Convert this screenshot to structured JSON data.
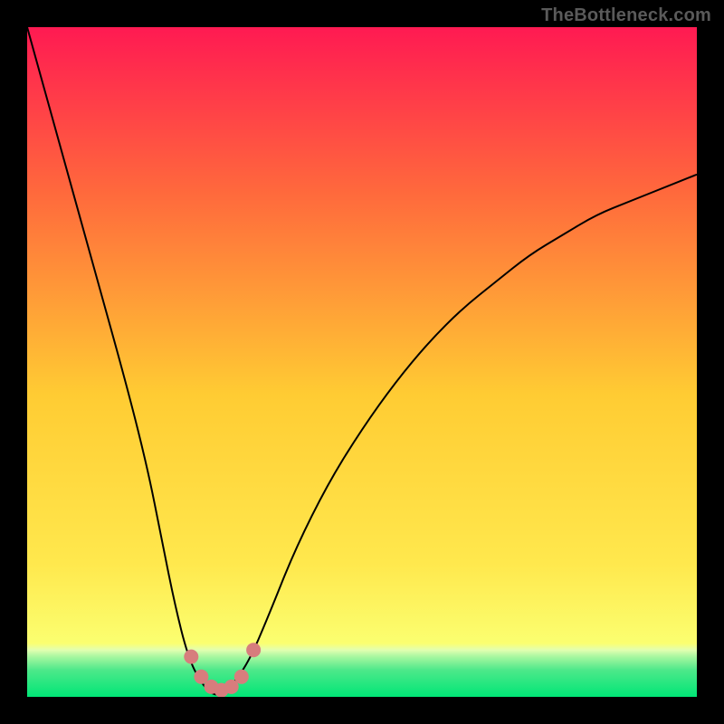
{
  "watermark": "TheBottleneck.com",
  "chart_data": {
    "type": "line",
    "title": "",
    "xlabel": "",
    "ylabel": "",
    "xlim": [
      0,
      100
    ],
    "ylim": [
      0,
      100
    ],
    "grid": false,
    "legend": false,
    "background_gradient": {
      "top_color": "#ff1a52",
      "mid_color": "#ffcc33",
      "bottom_band_color": "#00e676",
      "bottom_band_start_pct": 93
    },
    "series": [
      {
        "name": "bottleneck-curve",
        "x": [
          0,
          5,
          10,
          15,
          18,
          20,
          22,
          24,
          26,
          28,
          30,
          33,
          36,
          40,
          45,
          50,
          55,
          60,
          65,
          70,
          75,
          80,
          85,
          90,
          95,
          100
        ],
        "y": [
          100,
          82,
          64,
          46,
          34,
          24,
          14,
          6,
          2,
          0,
          1,
          5,
          12,
          22,
          32,
          40,
          47,
          53,
          58,
          62,
          66,
          69,
          72,
          74,
          76,
          78
        ]
      }
    ],
    "points": [
      {
        "name": "dot-1",
        "x": 24.5,
        "y": 6
      },
      {
        "name": "dot-2",
        "x": 26.0,
        "y": 3
      },
      {
        "name": "dot-3",
        "x": 27.5,
        "y": 1.5
      },
      {
        "name": "dot-4",
        "x": 29.0,
        "y": 1
      },
      {
        "name": "dot-5",
        "x": 30.5,
        "y": 1.5
      },
      {
        "name": "dot-6",
        "x": 32.0,
        "y": 3
      },
      {
        "name": "dot-7",
        "x": 33.8,
        "y": 7
      }
    ]
  }
}
